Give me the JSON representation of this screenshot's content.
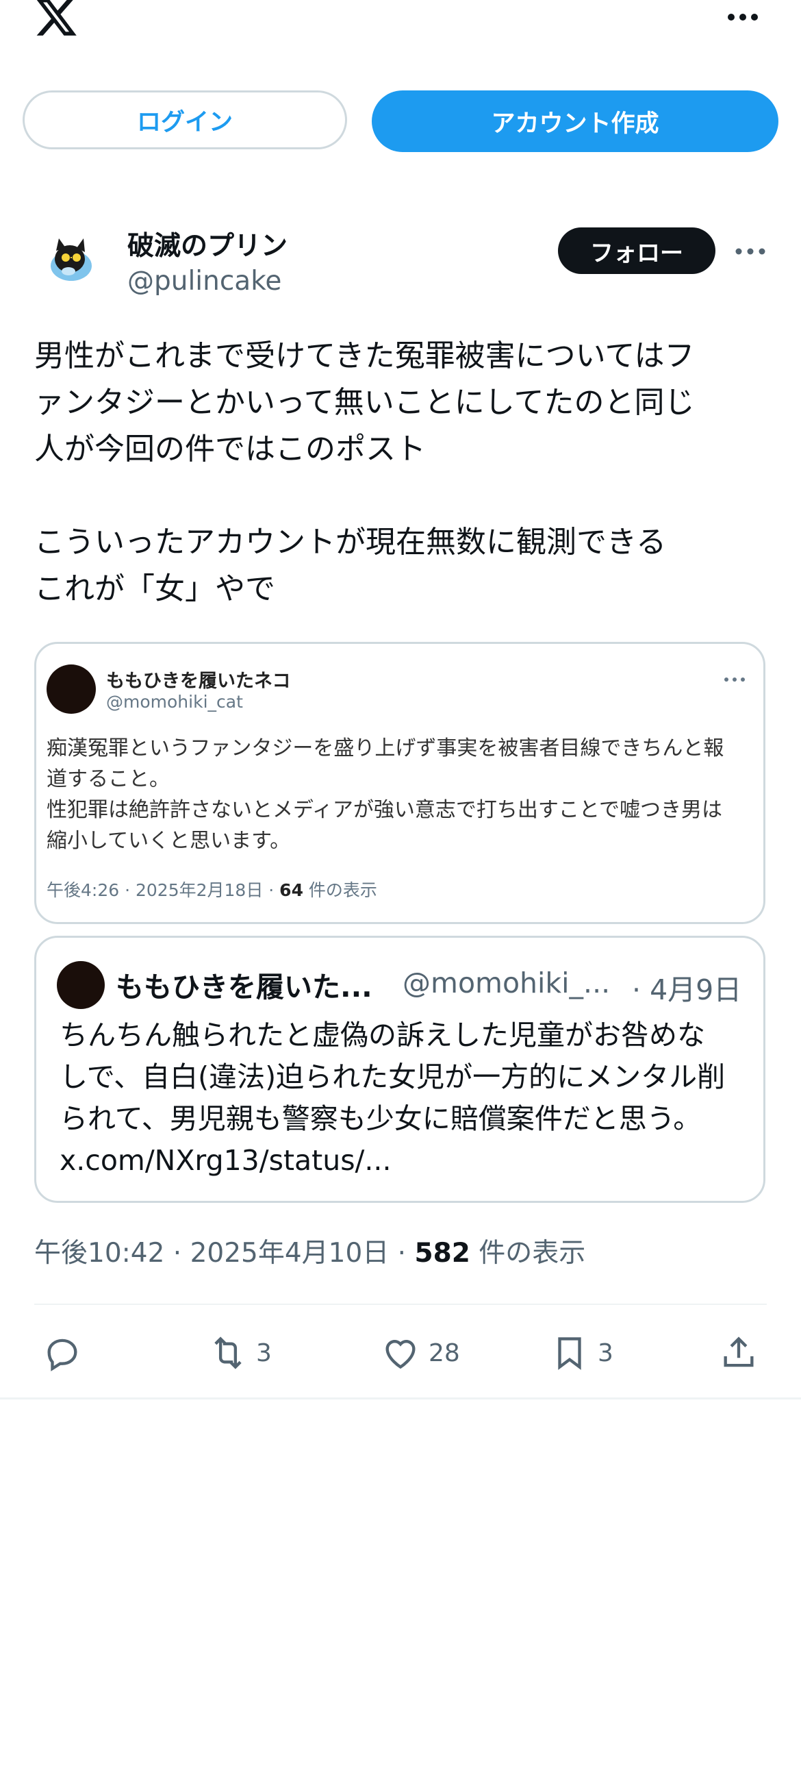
{
  "header": {
    "logo_icon": "x-logo-icon",
    "more_icon": "more-horizontal-icon"
  },
  "auth": {
    "login_label": "ログイン",
    "create_account_label": "アカウント作成"
  },
  "post": {
    "author_name": "破滅のプリン",
    "author_handle": "@pulincake",
    "follow_label": "フォロー",
    "text": "男性がこれまで受けてきた冤罪被害についてはフ\nァンタジーとかいって無いことにしてたのと同じ\n人が今回の件ではこのポスト\n\nこういったアカウントが現在無数に観測できる\nこれが「女」やで",
    "embedded_screenshot": {
      "name": "ももひきを履いたネコ",
      "handle": "@momohiki_cat",
      "text": "痴漢冤罪というファンタジーを盛り上げず事実を被害者目線できちんと報\n道すること。\n性犯罪は絶許許さないとメディアが強い意志で打ち出すことで嘘つき男は\n縮小していくと思います。",
      "meta_prefix": "午後4:26 · 2025年2月18日 · ",
      "views": "64",
      "views_suffix": " 件の表示"
    },
    "quoted": {
      "name": "ももひきを履いた...",
      "handle": "@momohiki_...",
      "date": "· 4月9日",
      "text": "ちんちん触られたと虚偽の訴えした児童がお咎めな\nしで、自白(違法)迫られた女児が一方的にメンタル削\nられて、男児親も警察も少女に賠償案件だと思う。\nx.com/NXrg13/status/..."
    },
    "timestamp_prefix": "午後10:42 · 2025年4月10日 · ",
    "views": "582",
    "views_suffix": " 件の表示",
    "actions": {
      "reply_icon": "reply-icon",
      "retweet_count": "3",
      "like_count": "28",
      "bookmark_count": "3",
      "share_icon": "share-icon"
    }
  },
  "colors": {
    "accent": "#1d9bf0",
    "text": "#0f1419",
    "secondary": "#536471",
    "border": "#cfd9de"
  }
}
